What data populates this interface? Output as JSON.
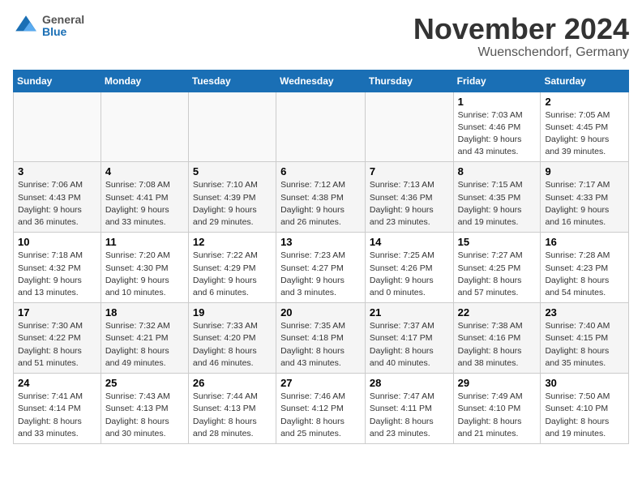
{
  "header": {
    "logo_line1": "General",
    "logo_line2": "Blue",
    "month_title": "November 2024",
    "location": "Wuenschendorf, Germany"
  },
  "weekdays": [
    "Sunday",
    "Monday",
    "Tuesday",
    "Wednesday",
    "Thursday",
    "Friday",
    "Saturday"
  ],
  "weeks": [
    [
      {
        "day": "",
        "info": "",
        "empty": true
      },
      {
        "day": "",
        "info": "",
        "empty": true
      },
      {
        "day": "",
        "info": "",
        "empty": true
      },
      {
        "day": "",
        "info": "",
        "empty": true
      },
      {
        "day": "",
        "info": "",
        "empty": true
      },
      {
        "day": "1",
        "info": "Sunrise: 7:03 AM\nSunset: 4:46 PM\nDaylight: 9 hours\nand 43 minutes.",
        "empty": false
      },
      {
        "day": "2",
        "info": "Sunrise: 7:05 AM\nSunset: 4:45 PM\nDaylight: 9 hours\nand 39 minutes.",
        "empty": false
      }
    ],
    [
      {
        "day": "3",
        "info": "Sunrise: 7:06 AM\nSunset: 4:43 PM\nDaylight: 9 hours\nand 36 minutes.",
        "empty": false
      },
      {
        "day": "4",
        "info": "Sunrise: 7:08 AM\nSunset: 4:41 PM\nDaylight: 9 hours\nand 33 minutes.",
        "empty": false
      },
      {
        "day": "5",
        "info": "Sunrise: 7:10 AM\nSunset: 4:39 PM\nDaylight: 9 hours\nand 29 minutes.",
        "empty": false
      },
      {
        "day": "6",
        "info": "Sunrise: 7:12 AM\nSunset: 4:38 PM\nDaylight: 9 hours\nand 26 minutes.",
        "empty": false
      },
      {
        "day": "7",
        "info": "Sunrise: 7:13 AM\nSunset: 4:36 PM\nDaylight: 9 hours\nand 23 minutes.",
        "empty": false
      },
      {
        "day": "8",
        "info": "Sunrise: 7:15 AM\nSunset: 4:35 PM\nDaylight: 9 hours\nand 19 minutes.",
        "empty": false
      },
      {
        "day": "9",
        "info": "Sunrise: 7:17 AM\nSunset: 4:33 PM\nDaylight: 9 hours\nand 16 minutes.",
        "empty": false
      }
    ],
    [
      {
        "day": "10",
        "info": "Sunrise: 7:18 AM\nSunset: 4:32 PM\nDaylight: 9 hours\nand 13 minutes.",
        "empty": false
      },
      {
        "day": "11",
        "info": "Sunrise: 7:20 AM\nSunset: 4:30 PM\nDaylight: 9 hours\nand 10 minutes.",
        "empty": false
      },
      {
        "day": "12",
        "info": "Sunrise: 7:22 AM\nSunset: 4:29 PM\nDaylight: 9 hours\nand 6 minutes.",
        "empty": false
      },
      {
        "day": "13",
        "info": "Sunrise: 7:23 AM\nSunset: 4:27 PM\nDaylight: 9 hours\nand 3 minutes.",
        "empty": false
      },
      {
        "day": "14",
        "info": "Sunrise: 7:25 AM\nSunset: 4:26 PM\nDaylight: 9 hours\nand 0 minutes.",
        "empty": false
      },
      {
        "day": "15",
        "info": "Sunrise: 7:27 AM\nSunset: 4:25 PM\nDaylight: 8 hours\nand 57 minutes.",
        "empty": false
      },
      {
        "day": "16",
        "info": "Sunrise: 7:28 AM\nSunset: 4:23 PM\nDaylight: 8 hours\nand 54 minutes.",
        "empty": false
      }
    ],
    [
      {
        "day": "17",
        "info": "Sunrise: 7:30 AM\nSunset: 4:22 PM\nDaylight: 8 hours\nand 51 minutes.",
        "empty": false
      },
      {
        "day": "18",
        "info": "Sunrise: 7:32 AM\nSunset: 4:21 PM\nDaylight: 8 hours\nand 49 minutes.",
        "empty": false
      },
      {
        "day": "19",
        "info": "Sunrise: 7:33 AM\nSunset: 4:20 PM\nDaylight: 8 hours\nand 46 minutes.",
        "empty": false
      },
      {
        "day": "20",
        "info": "Sunrise: 7:35 AM\nSunset: 4:18 PM\nDaylight: 8 hours\nand 43 minutes.",
        "empty": false
      },
      {
        "day": "21",
        "info": "Sunrise: 7:37 AM\nSunset: 4:17 PM\nDaylight: 8 hours\nand 40 minutes.",
        "empty": false
      },
      {
        "day": "22",
        "info": "Sunrise: 7:38 AM\nSunset: 4:16 PM\nDaylight: 8 hours\nand 38 minutes.",
        "empty": false
      },
      {
        "day": "23",
        "info": "Sunrise: 7:40 AM\nSunset: 4:15 PM\nDaylight: 8 hours\nand 35 minutes.",
        "empty": false
      }
    ],
    [
      {
        "day": "24",
        "info": "Sunrise: 7:41 AM\nSunset: 4:14 PM\nDaylight: 8 hours\nand 33 minutes.",
        "empty": false
      },
      {
        "day": "25",
        "info": "Sunrise: 7:43 AM\nSunset: 4:13 PM\nDaylight: 8 hours\nand 30 minutes.",
        "empty": false
      },
      {
        "day": "26",
        "info": "Sunrise: 7:44 AM\nSunset: 4:13 PM\nDaylight: 8 hours\nand 28 minutes.",
        "empty": false
      },
      {
        "day": "27",
        "info": "Sunrise: 7:46 AM\nSunset: 4:12 PM\nDaylight: 8 hours\nand 25 minutes.",
        "empty": false
      },
      {
        "day": "28",
        "info": "Sunrise: 7:47 AM\nSunset: 4:11 PM\nDaylight: 8 hours\nand 23 minutes.",
        "empty": false
      },
      {
        "day": "29",
        "info": "Sunrise: 7:49 AM\nSunset: 4:10 PM\nDaylight: 8 hours\nand 21 minutes.",
        "empty": false
      },
      {
        "day": "30",
        "info": "Sunrise: 7:50 AM\nSunset: 4:10 PM\nDaylight: 8 hours\nand 19 minutes.",
        "empty": false
      }
    ]
  ]
}
